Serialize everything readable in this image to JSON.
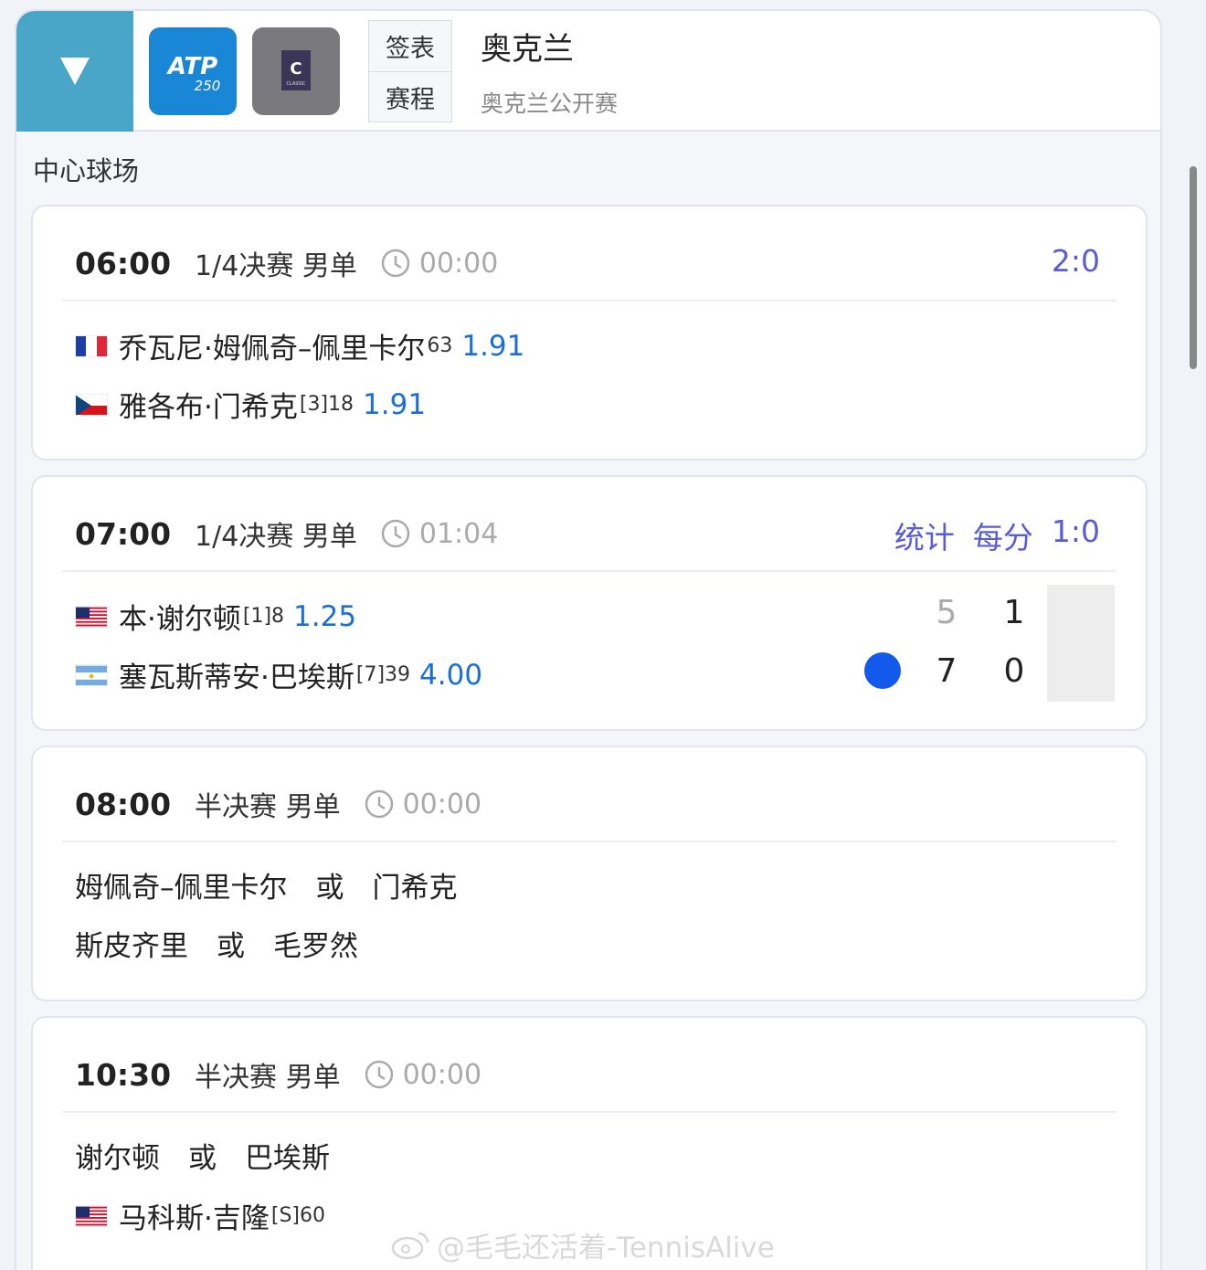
{
  "header": {
    "tabs": [
      "签表",
      "赛程"
    ],
    "title": "奥克兰",
    "subtitle": "奥克兰公开赛",
    "atp_logo_text": "ATP",
    "atp_logo_num": "250",
    "classic_logo_letter": "C",
    "classic_logo_text": "CLASSIC"
  },
  "court": "中心球场",
  "matches": [
    {
      "time": "06:00",
      "round": "1/4决赛 男单",
      "elapsed": "00:00",
      "score": "2:0",
      "players": [
        {
          "flag": "france",
          "name": "乔瓦尼·姆佩奇–佩里卡尔",
          "seed": "63",
          "odds": "1.91"
        },
        {
          "flag": "czech",
          "name": "雅各布·门希克",
          "seed": "[3]18",
          "odds": "1.91"
        }
      ]
    },
    {
      "time": "07:00",
      "round": "1/4决赛 男单",
      "elapsed": "01:04",
      "links": [
        "统计",
        "每分"
      ],
      "score": "1:0",
      "players": [
        {
          "flag": "usa",
          "name": "本·谢尔顿",
          "seed": "[1]8",
          "odds": "1.25",
          "set1": "5",
          "set2": "1"
        },
        {
          "flag": "argentina",
          "name": "塞瓦斯蒂安·巴埃斯",
          "seed": "[7]39",
          "odds": "4.00",
          "set1": "7",
          "set2": "0",
          "serving": true
        }
      ]
    },
    {
      "time": "08:00",
      "round": "半决赛 男单",
      "elapsed": "00:00",
      "rows": [
        "姆佩奇–佩里卡尔　或　门希克",
        "斯皮齐里　或　毛罗然"
      ]
    },
    {
      "time": "10:30",
      "round": "半决赛 男单",
      "elapsed": "00:00",
      "rows": [
        "谢尔顿　或　巴埃斯"
      ],
      "players": [
        {
          "flag": "usa",
          "name": "马科斯·吉隆",
          "seed": "[S]60"
        }
      ]
    }
  ],
  "watermark": "@毛毛还活着-TennisAlive"
}
